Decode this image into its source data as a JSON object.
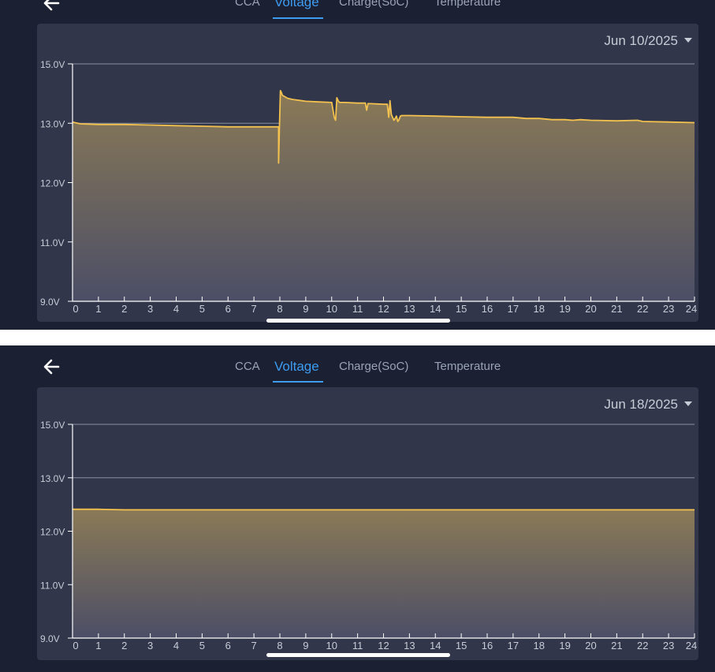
{
  "nav": {
    "back_icon": "arrow-left-icon",
    "tabs": [
      "CCA",
      "Voltage",
      "Charge(SoC)",
      "Temperature"
    ],
    "active_tab": "Voltage"
  },
  "colors": {
    "background": "#1b2133",
    "card": "#31364b",
    "accent": "#3d9bf0",
    "line": "#f2c14e",
    "fill_top": "#8b7a57",
    "fill_bottom": "#4b4e66",
    "grid": "#8a8fa0",
    "text": "#c8ccd6"
  },
  "screens": [
    {
      "date": "Jun 10/2025",
      "chart_data": {
        "type": "area",
        "title": "",
        "xlabel": "",
        "ylabel": "",
        "y_tick_labels": [
          "15.0V",
          "13.0V",
          "12.0V",
          "11.0V",
          "9.0V"
        ],
        "y_tick_values": [
          14.0,
          13.0,
          12.0,
          11.0,
          10.0
        ],
        "y_range": [
          10.0,
          14.0
        ],
        "x_ticks": [
          "0",
          "1",
          "2",
          "3",
          "4",
          "5",
          "6",
          "7",
          "8",
          "9",
          "10",
          "11",
          "12",
          "13",
          "14",
          "15",
          "16",
          "17",
          "18",
          "19",
          "20",
          "21",
          "22",
          "23",
          "24"
        ],
        "x_range": [
          0,
          24
        ],
        "grid": true,
        "series": [
          {
            "x": [
              0,
              0.3,
              1,
              2,
              3,
              4,
              5,
              6,
              7,
              7.95,
              7.95,
              7.98,
              8.02,
              8.05,
              8.1,
              8.3,
              8.5,
              9,
              9.5,
              10,
              10.1,
              10.15,
              10.2,
              10.25,
              10.3,
              10.5,
              11,
              11.3,
              11.35,
              11.4,
              11.5,
              12,
              12.15,
              12.2,
              12.25,
              12.3,
              12.35,
              12.4,
              12.45,
              12.5,
              12.55,
              12.6,
              12.65,
              12.7,
              13,
              14,
              15,
              16,
              17,
              17.5,
              18,
              18.5,
              19,
              19.3,
              19.6,
              20,
              21,
              21.8,
              22,
              23,
              24
            ],
            "y": [
              13.02,
              12.99,
              12.98,
              12.98,
              12.97,
              12.96,
              12.95,
              12.94,
              12.94,
              12.94,
              12.33,
              12.85,
              13.55,
              13.53,
              13.47,
              13.42,
              13.4,
              13.37,
              13.36,
              13.35,
              13.1,
              13.05,
              13.43,
              13.38,
              13.35,
              13.35,
              13.34,
              13.34,
              13.22,
              13.33,
              13.33,
              13.32,
              13.32,
              13.1,
              13.38,
              13.15,
              13.1,
              13.05,
              13.08,
              13.12,
              13.03,
              13.06,
              13.12,
              13.13,
              13.13,
              13.12,
              13.11,
              13.1,
              13.1,
              13.08,
              13.08,
              13.06,
              13.06,
              13.05,
              13.06,
              13.05,
              13.04,
              13.05,
              13.03,
              13.02,
              13.01
            ]
          }
        ]
      }
    },
    {
      "date": "Jun 18/2025",
      "chart_data": {
        "type": "area",
        "title": "",
        "xlabel": "",
        "ylabel": "",
        "y_tick_labels": [
          "15.0V",
          "13.0V",
          "12.0V",
          "11.0V",
          "9.0V"
        ],
        "y_tick_values": [
          14.0,
          13.0,
          12.0,
          11.0,
          10.0
        ],
        "y_range": [
          10.0,
          14.0
        ],
        "x_ticks": [
          "0",
          "1",
          "2",
          "3",
          "4",
          "5",
          "6",
          "7",
          "8",
          "9",
          "10",
          "11",
          "12",
          "13",
          "14",
          "15",
          "16",
          "17",
          "18",
          "19",
          "20",
          "21",
          "22",
          "23",
          "24"
        ],
        "x_range": [
          0,
          24
        ],
        "grid": true,
        "series": [
          {
            "x": [
              0,
              1,
              2,
              3,
              4,
              5,
              6,
              7,
              8,
              9,
              10,
              11,
              12,
              13,
              14,
              15,
              16,
              17,
              18,
              19,
              20,
              21,
              22,
              23,
              24
            ],
            "y": [
              12.41,
              12.41,
              12.4,
              12.4,
              12.4,
              12.4,
              12.4,
              12.4,
              12.4,
              12.4,
              12.4,
              12.4,
              12.4,
              12.4,
              12.4,
              12.4,
              12.4,
              12.4,
              12.4,
              12.4,
              12.4,
              12.4,
              12.4,
              12.4,
              12.4
            ]
          }
        ]
      }
    }
  ]
}
